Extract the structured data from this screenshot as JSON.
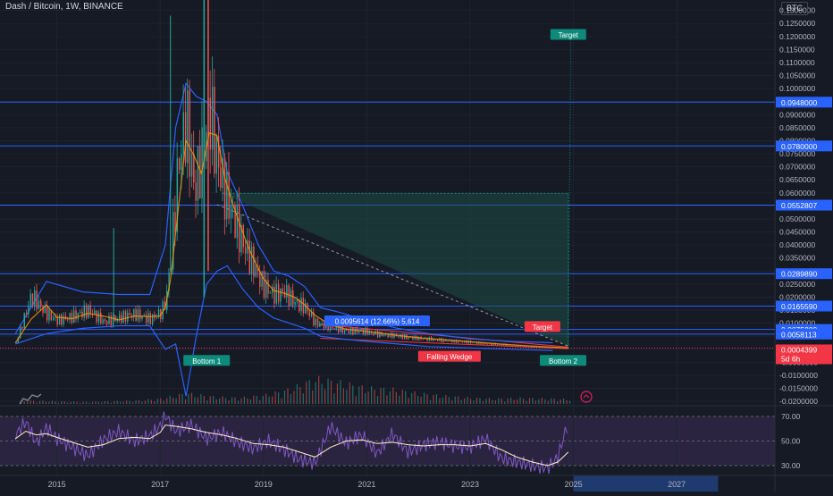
{
  "header": {
    "symbol": "Dash / Bitcoin, 1W, BINANCE",
    "currency": "BTC"
  },
  "colors": {
    "background": "#161a25",
    "grid": "#1f2330",
    "up": "#26a69a",
    "down": "#ef5350",
    "bollinger": "#2962ff",
    "ma": "#ff9800",
    "hline": "#2962ff",
    "wedge_fill": "#1f4d45",
    "rsi": "#7e57c2",
    "rsi_ma": "#fff3c4",
    "label_blue": "#2962ff",
    "label_green": "#0d8a7a",
    "label_red": "#f23645"
  },
  "price_axis": {
    "ticks": [
      "0.1300000",
      "0.1250000",
      "0.1200000",
      "0.1150000",
      "0.1100000",
      "0.1050000",
      "0.1000000",
      "0.0950000",
      "0.0900000",
      "0.0850000",
      "0.0800000",
      "0.0750000",
      "0.0700000",
      "0.0650000",
      "0.0600000",
      "0.0550000",
      "0.0500000",
      "0.0450000",
      "0.0400000",
      "0.0350000",
      "0.0300000",
      "0.0250000",
      "0.0200000",
      "0.0150000",
      "0.0100000",
      "0.0050000",
      "0.0000000",
      "-0.0050000",
      "-0.0100000",
      "-0.0150000",
      "-0.0200000"
    ],
    "tick_values": [
      0.13,
      0.125,
      0.12,
      0.115,
      0.11,
      0.105,
      0.1,
      0.095,
      0.09,
      0.085,
      0.08,
      0.075,
      0.07,
      0.065,
      0.06,
      0.055,
      0.05,
      0.045,
      0.04,
      0.035,
      0.03,
      0.025,
      0.02,
      0.015,
      0.01,
      0.005,
      0.0,
      -0.005,
      -0.01,
      -0.015,
      -0.02
    ],
    "range": [
      -0.021,
      0.134
    ]
  },
  "horizontal_levels": [
    {
      "label": "0.0948000",
      "value": 0.0948
    },
    {
      "label": "0.0780000",
      "value": 0.078
    },
    {
      "label": "0.0552807",
      "value": 0.0552807
    },
    {
      "label": "0.0289890",
      "value": 0.028989
    },
    {
      "label": "0.0165590",
      "value": 0.016559
    },
    {
      "label": "0.0075880",
      "value": 0.007588
    },
    {
      "label": "0.0058113",
      "value": 0.0058113
    }
  ],
  "current_price": {
    "label": "0.0004399",
    "countdown": "5d 6h",
    "value": 0.00044
  },
  "time_axis": {
    "labels": [
      "2015",
      "2017",
      "2019",
      "2021",
      "2023",
      "2025",
      "2027"
    ],
    "years": [
      2015,
      2017,
      2019,
      2021,
      2023,
      2025,
      2027
    ],
    "range": [
      2013.9,
      2028.9
    ],
    "highlight": [
      2025.0,
      2027.8
    ]
  },
  "annotations": {
    "target_top": {
      "text": "Target",
      "x": 2024.9,
      "y": 0.1208
    },
    "target_mid": {
      "text": "Target",
      "x": 2024.4,
      "y": 0.0087
    },
    "bottom1": {
      "text": "Bottom 1",
      "x": 2017.9,
      "y": -0.0043
    },
    "bottom2": {
      "text": "Bottom 2",
      "x": 2024.8,
      "y": -0.0043
    },
    "wedge": {
      "text": "Falling Wedge",
      "x": 2022.6,
      "y": -0.0027
    },
    "measure": {
      "text": "0.0095614 (12.66%) 5,614",
      "x": 2021.2,
      "y": 0.0109
    }
  },
  "rsi_axis": {
    "ticks": [
      "70.00",
      "50.00",
      "30.00"
    ],
    "tick_values": [
      70,
      50,
      30
    ],
    "range": [
      22,
      78
    ]
  },
  "chart_data": {
    "type": "line",
    "title": "Dash / Bitcoin, 1W, BINANCE",
    "x_unit": "year",
    "y_unit": "BTC",
    "series": [
      {
        "name": "",
        "x": [
          2014.2,
          2014.5,
          2014.8,
          2015.0,
          2015.3,
          2015.6,
          2015.9,
          2016.2,
          2016.5,
          2016.8,
          2017.0,
          2017.1,
          2017.2,
          2017.35,
          2017.5,
          2017.65,
          2017.8,
          2017.95,
          2018.1,
          2018.25,
          2018.4,
          2018.55,
          2018.7,
          2018.85,
          2019.0,
          2019.2,
          2019.4,
          2019.6,
          2019.8,
          2020.0,
          2020.3,
          2020.6,
          2020.9,
          2021.2,
          2021.5,
          2021.8,
          2022.1,
          2022.5,
          2022.9,
          2023.3,
          2023.7,
          2024.1,
          2024.5,
          2024.9
        ],
        "y": [
          0.0025,
          0.0205,
          0.0135,
          0.011,
          0.0125,
          0.015,
          0.0105,
          0.012,
          0.0135,
          0.0115,
          0.014,
          0.018,
          0.035,
          0.072,
          0.088,
          0.061,
          0.074,
          0.092,
          0.072,
          0.06,
          0.052,
          0.043,
          0.036,
          0.03,
          0.024,
          0.021,
          0.022,
          0.018,
          0.016,
          0.01,
          0.0085,
          0.007,
          0.007,
          0.0058,
          0.0052,
          0.0045,
          0.004,
          0.0033,
          0.0028,
          0.0021,
          0.0016,
          0.0011,
          0.0007,
          0.0004
        ]
      }
    ],
    "volume": {
      "x": [
        2014.5,
        2015,
        2015.5,
        2016,
        2016.5,
        2017,
        2017.5,
        2018,
        2018.5,
        2019,
        2019.5,
        2020,
        2020.5,
        2021,
        2021.5,
        2022,
        2022.5,
        2023,
        2023.5,
        2024,
        2024.5,
        2024.9
      ],
      "values": [
        0.5,
        0.4,
        0.3,
        0.4,
        0.5,
        0.8,
        1.6,
        1.1,
        0.9,
        1.3,
        2.2,
        3.8,
        3.2,
        2.4,
        2.2,
        1.6,
        1.2,
        0.9,
        0.8,
        0.9,
        0.8,
        0.7
      ]
    },
    "rsi": {
      "x": [
        2014.2,
        2014.4,
        2014.6,
        2014.8,
        2015.0,
        2015.3,
        2015.6,
        2015.9,
        2016.2,
        2016.5,
        2016.8,
        2017.0,
        2017.1,
        2017.3,
        2017.6,
        2017.9,
        2018.2,
        2018.5,
        2018.8,
        2019.1,
        2019.4,
        2019.7,
        2020.0,
        2020.3,
        2020.6,
        2020.9,
        2021.2,
        2021.5,
        2021.8,
        2022.1,
        2022.4,
        2022.7,
        2023.0,
        2023.3,
        2023.6,
        2023.9,
        2024.2,
        2024.5,
        2024.7,
        2024.9
      ],
      "values": [
        55,
        66,
        48,
        61,
        52,
        45,
        38,
        51,
        58,
        50,
        54,
        62,
        71,
        58,
        63,
        52,
        57,
        49,
        44,
        50,
        43,
        35,
        32,
        62,
        48,
        55,
        40,
        56,
        41,
        47,
        49,
        46,
        45,
        52,
        36,
        33,
        30,
        28,
        37,
        66
      ],
      "ma": [
        52,
        58,
        55,
        56,
        53,
        49,
        45,
        47,
        52,
        53,
        52,
        57,
        63,
        62,
        60,
        57,
        55,
        52,
        48,
        47,
        45,
        41,
        37,
        45,
        50,
        51,
        48,
        49,
        47,
        46,
        47,
        47,
        46,
        48,
        43,
        37,
        33,
        30,
        33,
        41
      ]
    },
    "bollinger": {
      "x": [
        2014.2,
        2014.8,
        2015.5,
        2016.2,
        2016.8,
        2017.1,
        2017.3,
        2017.5,
        2017.7,
        2017.9,
        2018.1,
        2018.3,
        2018.6,
        2018.9,
        2019.2,
        2019.5,
        2019.8,
        2020.1,
        2020.5,
        2021.0,
        2021.6,
        2022.2,
        2023.0,
        2023.8,
        2024.6
      ],
      "upper": [
        0.006,
        0.026,
        0.022,
        0.021,
        0.021,
        0.04,
        0.085,
        0.102,
        0.097,
        0.095,
        0.09,
        0.068,
        0.055,
        0.04,
        0.03,
        0.028,
        0.024,
        0.016,
        0.014,
        0.011,
        0.008,
        0.006,
        0.004,
        0.003,
        0.0025
      ],
      "lower": [
        0.002,
        0.006,
        0.008,
        0.009,
        0.009,
        0.0,
        0.002,
        -0.018,
        0.005,
        0.025,
        0.03,
        0.032,
        0.023,
        0.016,
        0.012,
        0.01,
        0.008,
        0.005,
        0.004,
        0.003,
        0.002,
        0.001,
        0.0005,
        0.0,
        -0.0005
      ]
    }
  }
}
